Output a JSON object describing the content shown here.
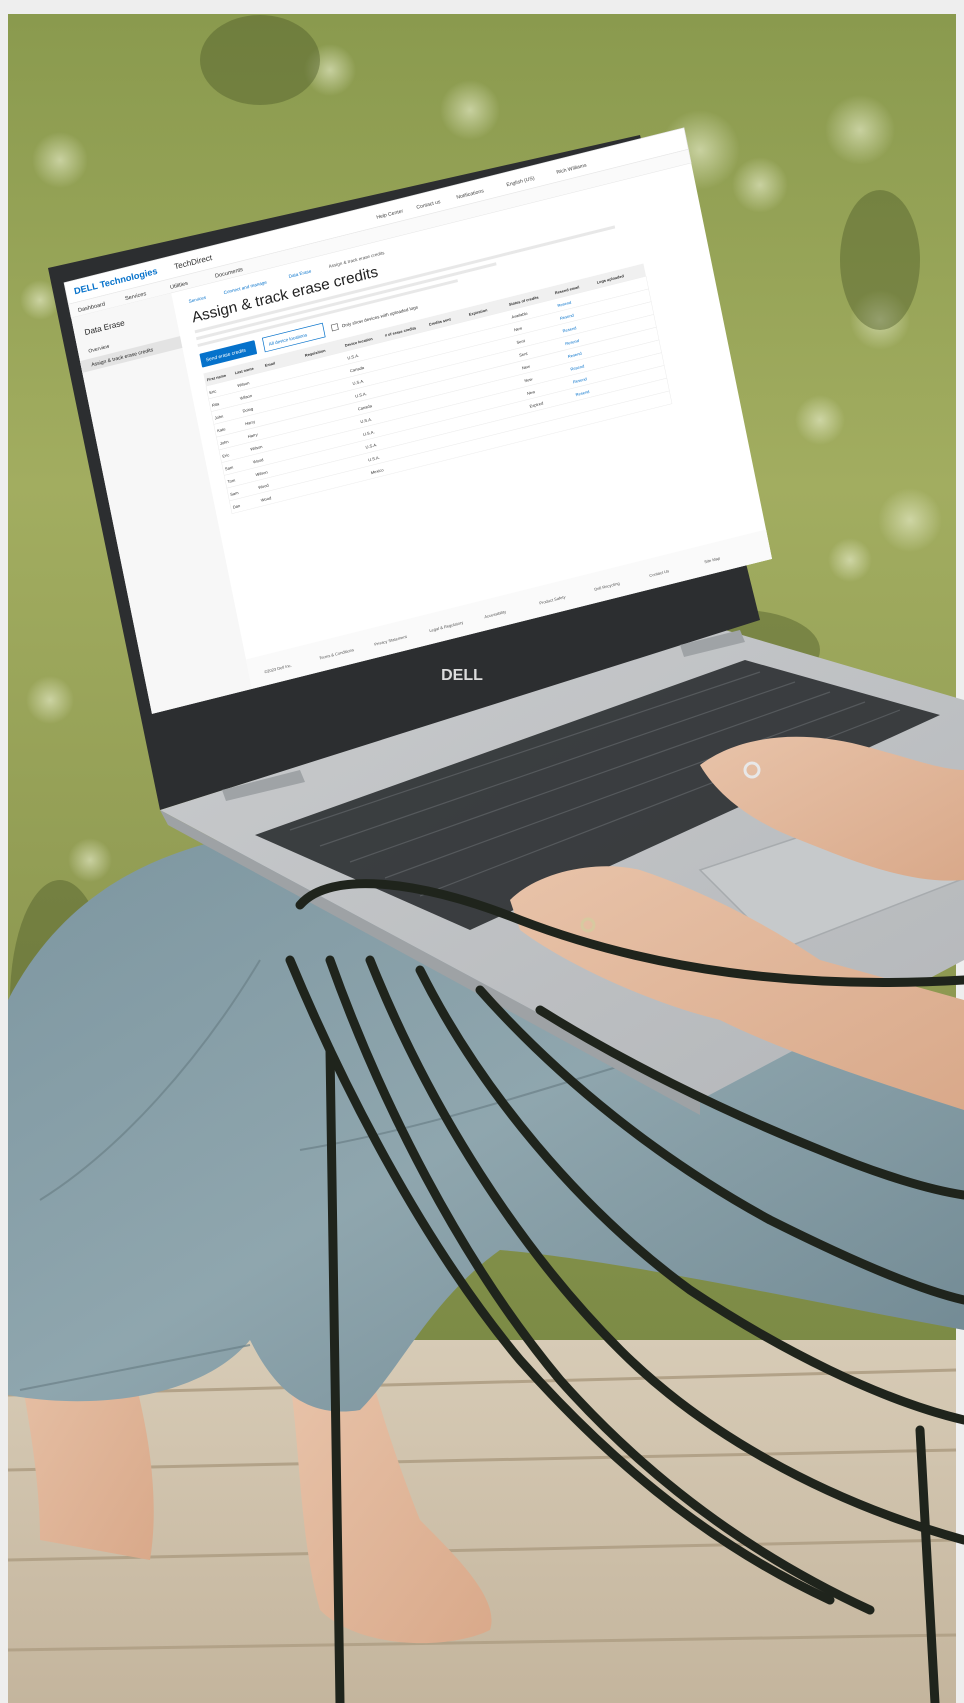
{
  "techdirect": {
    "brand": "DELL Technologies",
    "product": "TechDirect",
    "nav": [
      "Dashboard",
      "Services",
      "Utilities",
      "Documents"
    ],
    "top_links": [
      "Help Center",
      "Contact us",
      "Notifications",
      "English (US)",
      "Rich Williams"
    ],
    "sidebar_title": "Data Erase",
    "sidebar_items": [
      "Overview",
      "Assign & track erase credits"
    ],
    "breadcrumb": [
      "Services",
      "Connect and manage",
      "Data Erase",
      "Assign & track erase credits"
    ],
    "page_title": "Assign & track erase credits",
    "send_button": "Send erase credits",
    "filter_button": "All device locations",
    "checkbox_label": "Only show devices with uploaded logs",
    "columns": [
      "First name",
      "Last name",
      "Email",
      "Requisition",
      "Device location",
      "# of erase credits",
      "Credits sent",
      "Expiration",
      "Status of credits",
      "Resend email",
      "Logs uploaded"
    ],
    "first_names": [
      "Eric",
      "Rita",
      "John",
      "Kate",
      "John",
      "Eric",
      "Sam",
      "Tom",
      "Sam",
      "Dan"
    ],
    "last_names": [
      "Wilson",
      "Wilson",
      "Doing",
      "Harry",
      "Harry",
      "Wilson",
      "Wood",
      "Wilson",
      "Wood",
      "Wood"
    ],
    "locations": [
      "U.S.A.",
      "Canada",
      "U.S.A.",
      "U.S.A.",
      "Canada",
      "U.S.A.",
      "U.S.A.",
      "U.S.A.",
      "U.S.A.",
      "Mexico"
    ],
    "statuses": [
      "Available",
      "New",
      "Sent",
      "Sent",
      "New",
      "New",
      "New",
      "Expired"
    ],
    "resend": "Resend",
    "footer": [
      "©2023 Dell Inc.",
      "Terms & Conditions",
      "Privacy Statement",
      "Legal & Regulatory",
      "Accessibility",
      "Product Safety",
      "Dell Recycling",
      "Contact Us",
      "Site Map"
    ],
    "laptop_logo": "DELL"
  }
}
